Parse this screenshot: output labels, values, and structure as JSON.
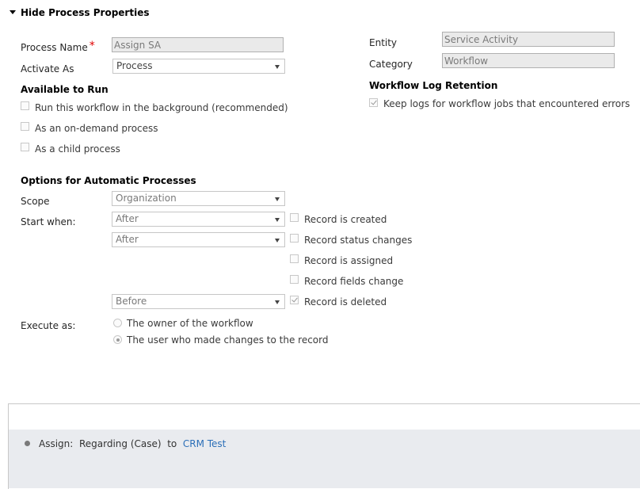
{
  "section": {
    "toggle_label": "Hide Process Properties"
  },
  "left": {
    "process_name": {
      "label": "Process Name",
      "value": "Assign SA"
    },
    "activate_as": {
      "label": "Activate As",
      "value": "Process"
    }
  },
  "right": {
    "entity": {
      "label": "Entity",
      "value": "Service Activity"
    },
    "category": {
      "label": "Category",
      "value": "Workflow"
    },
    "log_retention": {
      "heading": "Workflow Log Retention",
      "keep_logs": {
        "label": "Keep logs for workflow jobs that encountered errors",
        "checked": true
      }
    }
  },
  "available_to_run": {
    "heading": "Available to Run",
    "options": [
      {
        "label": "Run this workflow in the background (recommended)",
        "checked": false
      },
      {
        "label": "As an on-demand process",
        "checked": false
      },
      {
        "label": "As a child process",
        "checked": false
      }
    ]
  },
  "automatic": {
    "heading": "Options for Automatic Processes",
    "scope": {
      "label": "Scope",
      "value": "Organization"
    },
    "start_when": {
      "label": "Start when:",
      "selects": [
        "After",
        "After",
        "Before"
      ],
      "triggers": [
        {
          "label": "Record is created",
          "checked": false
        },
        {
          "label": "Record status changes",
          "checked": false
        },
        {
          "label": "Record is assigned",
          "checked": false
        },
        {
          "label": "Record fields change",
          "checked": false
        },
        {
          "label": "Record is deleted",
          "checked": true
        }
      ]
    },
    "execute_as": {
      "label": "Execute as:",
      "options": [
        {
          "label": "The owner of the workflow",
          "selected": false
        },
        {
          "label": "The user who made changes to the record",
          "selected": true
        }
      ]
    }
  },
  "step": {
    "action": "Assign:",
    "target": "Regarding (Case)",
    "connector": "to",
    "assignee": "CRM Test"
  }
}
